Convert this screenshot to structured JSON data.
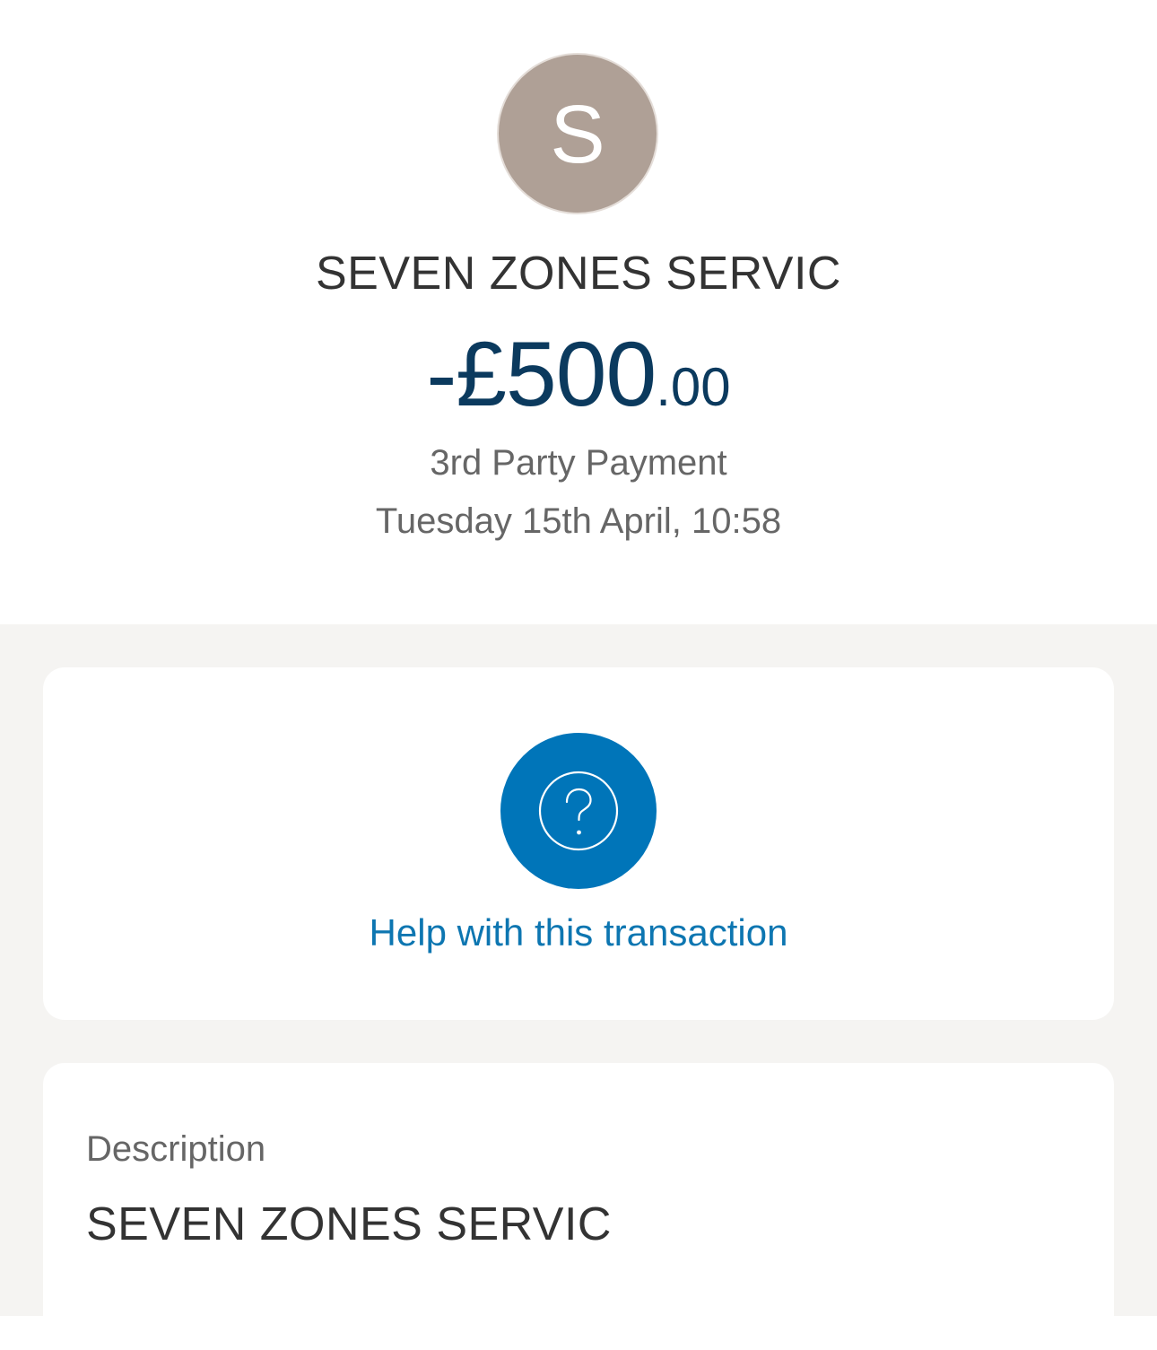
{
  "transaction": {
    "avatar_initial": "S",
    "merchant": "SEVEN ZONES SERVIC",
    "amount_main": "-£500",
    "amount_pence": ".00",
    "type": "3rd Party Payment",
    "datetime": "Tuesday 15th April, 10:58"
  },
  "help": {
    "icon": "question-circle-icon",
    "label": "Help with this transaction"
  },
  "description": {
    "label": "Description",
    "value": "SEVEN ZONES SERVIC"
  },
  "colors": {
    "avatar": "#afa096",
    "amount": "#0b3a5e",
    "help_circle": "#0075b9",
    "link": "#0d76b1",
    "background": "#f5f4f2"
  }
}
